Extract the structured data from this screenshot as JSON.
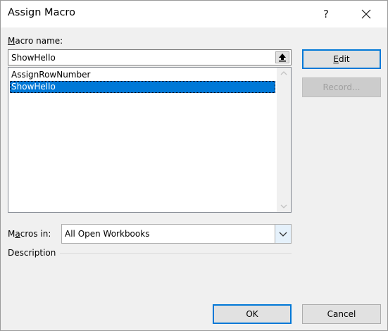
{
  "window": {
    "title": "Assign Macro",
    "help_label": "?",
    "close_icon": "close-icon"
  },
  "macro_name": {
    "label_mnemonic": "M",
    "label_rest": "acro name:",
    "value": "ShowHello"
  },
  "macro_list": {
    "items": [
      {
        "label": "AssignRowNumber",
        "selected": false
      },
      {
        "label": "ShowHello",
        "selected": true
      }
    ]
  },
  "buttons": {
    "edit_mnemonic": "E",
    "edit_rest": "dit",
    "record": "Record...",
    "ok": "OK",
    "cancel": "Cancel"
  },
  "macros_in": {
    "label_pre": "M",
    "label_mnemonic": "a",
    "label_rest": "cros in:",
    "value": "All Open Workbooks"
  },
  "description": {
    "label": "Description"
  },
  "colors": {
    "selection": "#0078d7",
    "dialog_bg": "#f0f0f0",
    "default_border": "#0078d7"
  }
}
